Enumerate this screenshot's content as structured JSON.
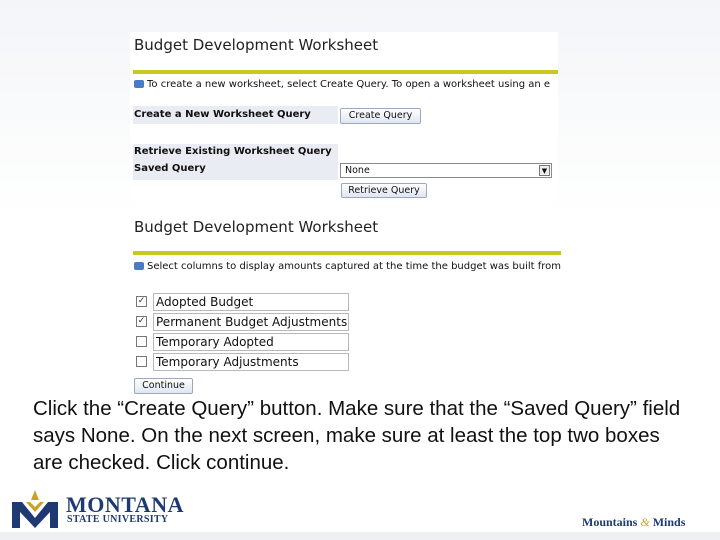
{
  "worksheet1": {
    "title": "Budget Development Worksheet",
    "info": "To create a new worksheet, select Create Query. To open a worksheet using an e",
    "create_label": "Create a New Worksheet Query",
    "create_button": "Create Query",
    "retrieve_heading": "Retrieve Existing Worksheet Query",
    "saved_query_label": "Saved Query",
    "saved_query_value": "None",
    "retrieve_button": "Retrieve Query"
  },
  "worksheet2": {
    "title": "Budget Development Worksheet",
    "info": "Select columns to display amounts captured at the time the budget was built from",
    "columns": [
      {
        "label": "Adopted Budget",
        "checked": true
      },
      {
        "label": "Permanent Budget Adjustments",
        "checked": true
      },
      {
        "label": "Temporary Adopted",
        "checked": false
      },
      {
        "label": "Temporary Adjustments",
        "checked": false
      }
    ],
    "continue_button": "Continue"
  },
  "caption": "Click the “Create Query” button.  Make sure that the “Saved Query” field says None.  On the next screen, make sure at least the top two boxes are checked.  Click continue.",
  "branding": {
    "logo_line1": "MONTANA",
    "logo_line2": "STATE UNIVERSITY",
    "tagline_a": "Mountains",
    "tagline_amp": "&",
    "tagline_b": "Minds",
    "navy": "#1f3a72",
    "gold": "#c9a227"
  }
}
